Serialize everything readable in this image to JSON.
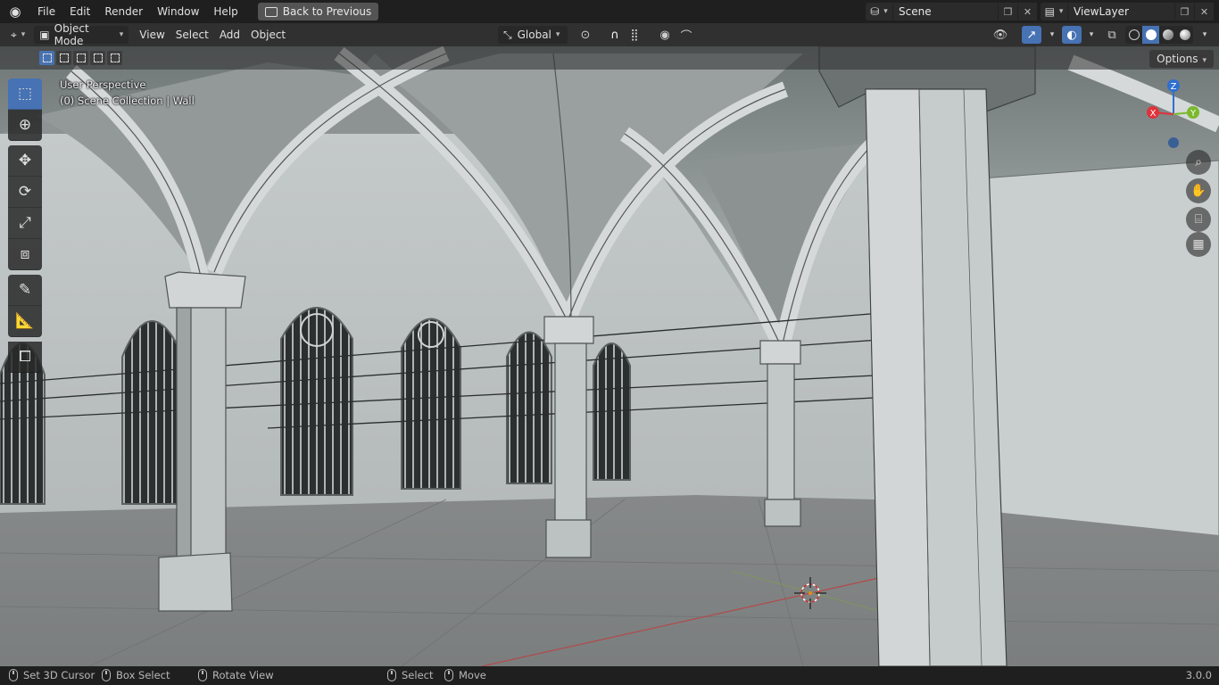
{
  "topbar": {
    "logo": "blender-logo",
    "menus": [
      "File",
      "Edit",
      "Render",
      "Window",
      "Help"
    ],
    "back_button": "Back to Previous",
    "scene": "Scene",
    "view_layer": "ViewLayer"
  },
  "header": {
    "mode": "Object Mode",
    "menus": [
      "View",
      "Select",
      "Add",
      "Object"
    ],
    "orientation": "Global"
  },
  "viewport": {
    "view_name": "User Perspective",
    "collection_info": "(0) Scene Collection | Wall",
    "options_label": "Options",
    "gizmo": {
      "x": "X",
      "y": "Y",
      "z": "Z"
    }
  },
  "toolbar": {
    "tools": [
      "select-box",
      "cursor",
      "move",
      "rotate",
      "scale",
      "transform",
      "annotate",
      "measure",
      "add-cube"
    ],
    "active_tool": "select-box"
  },
  "statusbar": {
    "items": [
      "Set 3D Cursor",
      "Box Select",
      "Rotate View",
      "Select",
      "Move"
    ],
    "version": "3.0.0"
  },
  "colors": {
    "accent": "#4772b3",
    "axis_x": "#e0323a",
    "axis_y": "#7ab92d",
    "axis_z": "#2e6fcf"
  }
}
